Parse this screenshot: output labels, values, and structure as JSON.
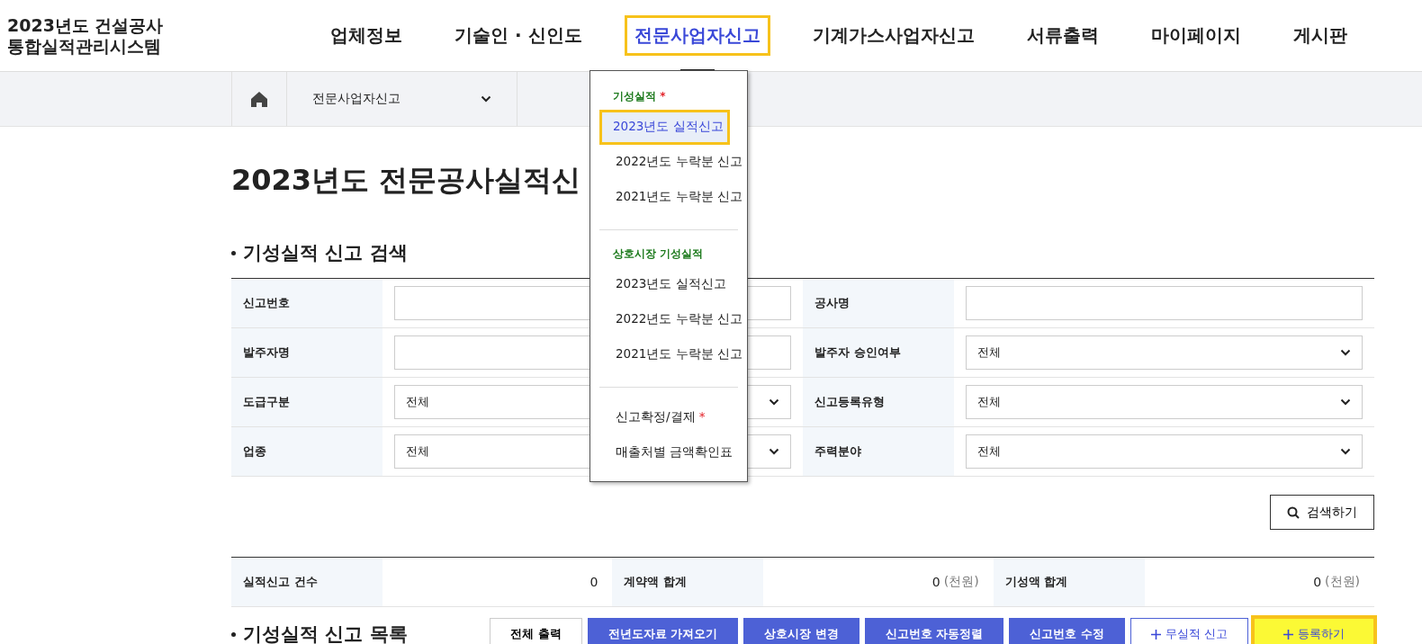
{
  "logo": {
    "line1": "2023년도 건설공사",
    "line2": "통합실적관리시스템"
  },
  "nav": [
    {
      "label": "업체정보",
      "selected": false
    },
    {
      "label": "기술인 · 신인도",
      "selected": false
    },
    {
      "label": "전문사업자신고",
      "selected": true
    },
    {
      "label": "기계가스사업자신고",
      "selected": false
    },
    {
      "label": "서류출력",
      "selected": false
    },
    {
      "label": "마이페이지",
      "selected": false
    },
    {
      "label": "게시판",
      "selected": false
    }
  ],
  "breadcrumb": {
    "current": "전문사업자신고"
  },
  "dropdown": {
    "sections": [
      {
        "kind": "heading",
        "label": "기성실적",
        "mark": "*",
        "items": [
          {
            "label": "2023년도 실적신고",
            "selected": true
          },
          {
            "label": "2022년도 누락분 신고",
            "selected": false
          },
          {
            "label": "2021년도 누락분 신고",
            "selected": false
          }
        ]
      },
      {
        "kind": "heading",
        "label": "상호시장 기성실적",
        "items": [
          {
            "label": "2023년도 실적신고",
            "selected": false
          },
          {
            "label": "2022년도 누락분 신고",
            "selected": false
          },
          {
            "label": "2021년도 누락분 신고",
            "selected": false
          }
        ]
      },
      {
        "kind": "plain",
        "items": [
          {
            "label": "신고확정/결제",
            "mark": "*",
            "selected": false
          },
          {
            "label": "매출처별 금액확인표",
            "selected": false
          }
        ]
      }
    ]
  },
  "page_title": "2023년도 전문공사실적신",
  "search": {
    "title": "기성실적 신고 검색",
    "rows": [
      [
        {
          "label": "신고번호",
          "kind": "input"
        },
        {
          "label": "공사명",
          "kind": "input"
        }
      ],
      [
        {
          "label": "발주자명",
          "kind": "input"
        },
        {
          "label": "발주자 승인여부",
          "kind": "select",
          "value": "전체"
        }
      ],
      [
        {
          "label": "도급구분",
          "kind": "select",
          "value": "전체"
        },
        {
          "label": "신고등록유형",
          "kind": "select",
          "value": "전체"
        }
      ],
      [
        {
          "label": "업종",
          "kind": "select",
          "value": "전체"
        },
        {
          "label": "주력분야",
          "kind": "select",
          "value": "전체"
        }
      ]
    ],
    "button": "검색하기"
  },
  "summary": [
    {
      "label": "실적신고 건수",
      "value": "0"
    },
    {
      "label": "계약액 합계",
      "value": "0",
      "unit": "(천원)"
    },
    {
      "label": "기성액 합계",
      "value": "0",
      "unit": "(천원)"
    }
  ],
  "list": {
    "title": "기성실적 신고 목록",
    "buttons": [
      {
        "label": "전체 출력",
        "kind": "outline"
      },
      {
        "label": "전년도자료 가져오기",
        "kind": "blue"
      },
      {
        "label": "상호시장 변경",
        "kind": "blue"
      },
      {
        "label": "신고번호 자동정렬",
        "kind": "blue"
      },
      {
        "label": "신고번호 수정",
        "kind": "blue"
      },
      {
        "label": "무실적 신고",
        "kind": "add"
      },
      {
        "label": "등록하기",
        "kind": "highlight"
      }
    ]
  }
}
